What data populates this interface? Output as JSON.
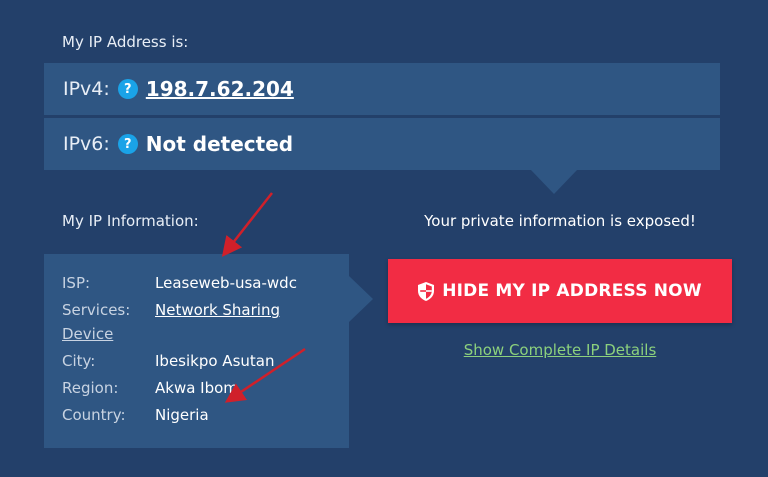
{
  "header": {
    "my_ip_title": "My IP Address is:"
  },
  "ip": {
    "ipv4_label": "IPv4:",
    "ipv4_value": "198.7.62.204",
    "ipv6_label": "IPv6:",
    "ipv6_value": "Not detected",
    "help_glyph": "?"
  },
  "info": {
    "title": "My IP Information:",
    "rows": [
      {
        "key": "ISP:",
        "value": "Leaseweb-usa-wdc"
      },
      {
        "key": "Services:",
        "value_line1": "Network Sharing",
        "value_line2": "Device"
      },
      {
        "key": "City:",
        "value": "Ibesikpo Asutan"
      },
      {
        "key": "Region:",
        "value": "Akwa Ibom"
      },
      {
        "key": "Country:",
        "value": "Nigeria"
      }
    ]
  },
  "cta": {
    "warning": "Your private information is exposed!",
    "hide_button": "HIDE MY IP ADDRESS NOW",
    "details_link": "Show Complete IP Details"
  },
  "icons": {
    "help": "question-circle-icon",
    "shield": "shield-icon",
    "annotation": "red-arrow-annotation"
  },
  "colors": {
    "background": "#23406a",
    "panel": "#2f5683",
    "help_badge": "#1aa3e8",
    "button": "#f22c44",
    "link_green": "#8cd17d",
    "annotation_red": "#d0202a"
  }
}
